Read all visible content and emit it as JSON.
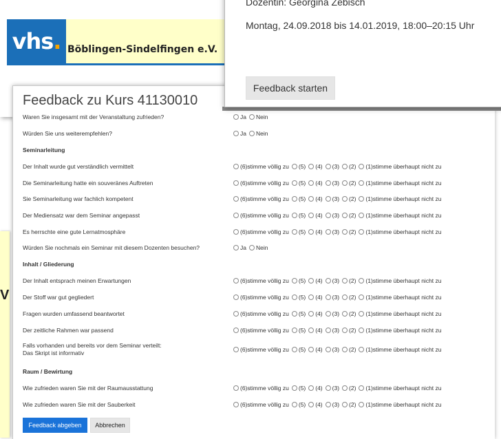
{
  "vhs": {
    "logo_text": "vhs",
    "logo_dot": ".",
    "org_name": "Böblingen-Sindelfingen e.V."
  },
  "course": {
    "dozent": "Dozentin: Georgina Zebisch",
    "date": "Montag, 24.09.2018 bis 14.01.2019, 18:00–20:15 Uhr",
    "start_label": "Feedback starten"
  },
  "left_window": {
    "fragment": "V"
  },
  "form": {
    "title": "Feedback zu Kurs 41130010",
    "yes_no": {
      "yes": "Ja",
      "no": "Nein"
    },
    "scale": [
      "(6)stimme völlig zu",
      "(5)",
      "(4)",
      "(3)",
      "(2)",
      "(1)stimme überhaupt nicht zu"
    ],
    "rows": [
      {
        "type": "yesno",
        "text": "Waren Sie insgesamt mit der Veranstaltung zufrieden?"
      },
      {
        "type": "yesno",
        "text": "Würden Sie uns weiterempfehlen?"
      },
      {
        "type": "section",
        "text": "Seminarleitung"
      },
      {
        "type": "scale",
        "text": "Der Inhalt wurde gut verständlich vermittelt"
      },
      {
        "type": "scale",
        "text": "Die Seminarleitung hatte ein souveränes Auftreten"
      },
      {
        "type": "scale",
        "text": "Sie Seminarleitung war fachlich kompetent"
      },
      {
        "type": "scale",
        "text": "Der Mediensatz war dem Seminar angepasst"
      },
      {
        "type": "scale",
        "text": "Es herrschte eine gute Lernatmosphäre"
      },
      {
        "type": "yesno",
        "text": "Würden Sie nochmals ein Seminar mit diesem Dozenten besuchen?"
      },
      {
        "type": "section",
        "text": "Inhalt / Gliederung"
      },
      {
        "type": "scale",
        "text": "Der Inhalt entsprach meinen Erwartungen"
      },
      {
        "type": "scale",
        "text": "Der Stoff war gut gegliedert"
      },
      {
        "type": "scale",
        "text": "Fragen wurden umfassend beantwortet"
      },
      {
        "type": "scale",
        "text": "Der zeitliche Rahmen war passend"
      },
      {
        "type": "scale2",
        "text": "Falls vorhanden und bereits vor dem Seminar verteilt:",
        "text2": "Das Skript ist informativ"
      },
      {
        "type": "section",
        "text": "Raum / Bewirtung"
      },
      {
        "type": "scale",
        "text": "Wie zufrieden waren Sie mit der Raumausstattung"
      },
      {
        "type": "scale",
        "text": "Wie zufrieden waren Sie mit der Sauberkeit"
      }
    ],
    "submit_label": "Feedback abgeben",
    "cancel_label": "Abbrechen"
  }
}
